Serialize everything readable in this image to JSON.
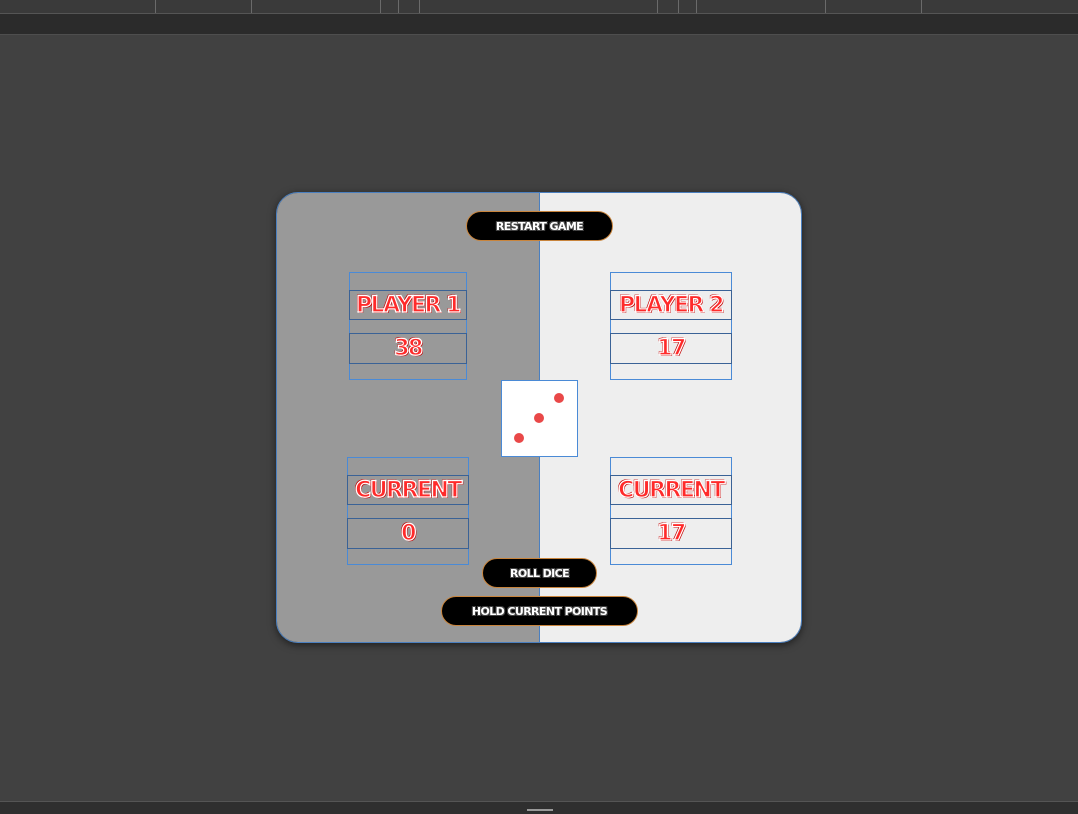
{
  "game": {
    "restart_label": "RESTART GAME",
    "roll_label": "ROLL DICE",
    "hold_label": "HOLD CURRENT POINTS",
    "dice_value": 3,
    "player1": {
      "name": "PLAYER 1",
      "score": "38",
      "current_label": "CURRENT",
      "current": "0"
    },
    "player2": {
      "name": "PLAYER 2",
      "score": "17",
      "current_label": "CURRENT",
      "current": "17"
    }
  },
  "colors": {
    "active_panel": "#999999",
    "inactive_panel": "#eeeeee",
    "text_red": "#ff2a2a",
    "pip": "#e94848",
    "button_bg": "#000000",
    "button_border": "#c8843c"
  }
}
